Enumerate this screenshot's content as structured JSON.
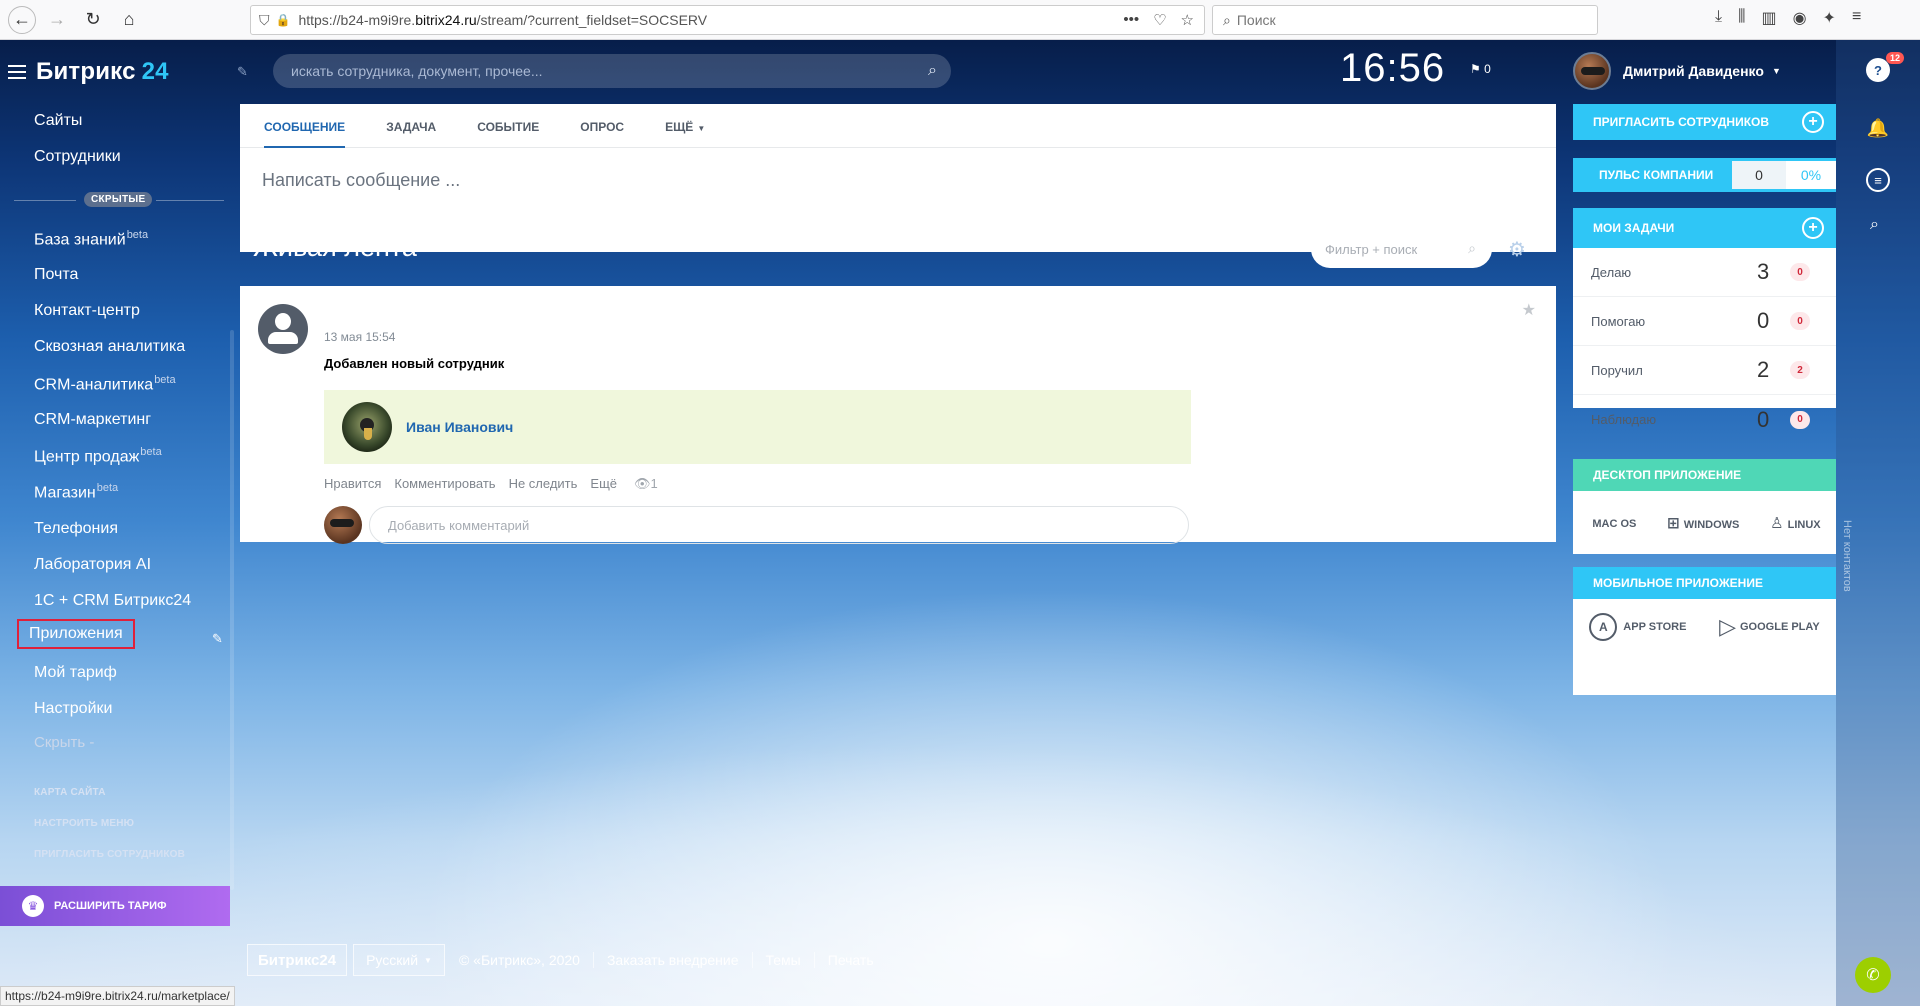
{
  "browser": {
    "url_prefix": "https://b24-m9i9re.",
    "url_host": "bitrix24.ru",
    "url_path": "/stream/?current_fieldset=SOCSERV",
    "search_placeholder": "Поиск",
    "status_url": "https://b24-m9i9re.bitrix24.ru/marketplace/"
  },
  "header": {
    "logo_name": "Битрикс",
    "logo_num": "24",
    "search_placeholder": "искать сотрудника, документ, прочее...",
    "clock": "16:56",
    "flag_count": "0",
    "user_name": "Дмитрий Давиденко"
  },
  "sidebar": {
    "top_items": [
      "Сайты",
      "Сотрудники"
    ],
    "hidden_label": "СКРЫТЫЕ",
    "items": [
      {
        "label": "База знаний",
        "sup": "beta"
      },
      {
        "label": "Почта",
        "sup": ""
      },
      {
        "label": "Контакт-центр",
        "sup": ""
      },
      {
        "label": "Сквозная аналитика",
        "sup": ""
      },
      {
        "label": "CRM-аналитика",
        "sup": "beta"
      },
      {
        "label": "CRM-маркетинг",
        "sup": ""
      },
      {
        "label": "Центр продаж",
        "sup": "beta"
      },
      {
        "label": "Магазин",
        "sup": "beta"
      },
      {
        "label": "Телефония",
        "sup": ""
      },
      {
        "label": "Лаборатория AI",
        "sup": ""
      },
      {
        "label": "1С + CRM Битрикс24",
        "sup": ""
      }
    ],
    "active_item": "Приложения",
    "after_items": [
      "Мой тариф",
      "Настройки",
      "Скрыть -"
    ],
    "small_links": [
      "КАРТА САЙТА",
      "НАСТРОИТЬ МЕНЮ",
      "ПРИГЛАСИТЬ СОТРУДНИКОВ"
    ],
    "upgrade_label": "РАСШИРИТЬ ТАРИФ"
  },
  "composer": {
    "tabs": [
      "СООБЩЕНИЕ",
      "ЗАДАЧА",
      "СОБЫТИЕ",
      "ОПРОС",
      "ЕЩЁ"
    ],
    "placeholder": "Написать сообщение ..."
  },
  "feed": {
    "title": "Живая лента",
    "filter_placeholder": "Фильтр + поиск"
  },
  "post": {
    "date": "13 мая 15:54",
    "title": "Добавлен новый сотрудник",
    "user": "Иван Иванович",
    "actions": [
      "Нравится",
      "Комментировать",
      "Не следить",
      "Ещё"
    ],
    "views": "1",
    "comment_placeholder": "Добавить комментарий"
  },
  "widgets": {
    "invite_label": "ПРИГЛАСИТЬ СОТРУДНИКОВ",
    "pulse_label": "ПУЛЬС КОМПАНИИ",
    "pulse_value": "0",
    "pulse_pct": "0%",
    "tasks_title": "МОИ ЗАДАЧИ",
    "tasks": [
      {
        "label": "Делаю",
        "count": "3",
        "badge": "0"
      },
      {
        "label": "Помогаю",
        "count": "0",
        "badge": "0"
      },
      {
        "label": "Поручил",
        "count": "2",
        "badge": "2"
      },
      {
        "label": "Наблюдаю",
        "count": "0",
        "badge": "0"
      }
    ],
    "desktop_title": "ДЕСКТОП ПРИЛОЖЕНИЕ",
    "desktop_apps": [
      "MAC OS",
      "WINDOWS",
      "LINUX"
    ],
    "mobile_title": "МОБИЛЬНОЕ ПРИЛОЖЕНИЕ",
    "mobile_apps": [
      "APP STORE",
      "GOOGLE PLAY"
    ]
  },
  "rail": {
    "help_badge": "12",
    "vertical_text": "Нет контактов"
  },
  "footer": {
    "logo": "Битрикс24",
    "lang": "Русский",
    "copyright": "© «Битрикс», 2020",
    "links": [
      "Заказать внедрение",
      "Темы",
      "Печать"
    ]
  },
  "colors": {
    "accent": "#2fc6f6",
    "link": "#2067b0",
    "desktop_head": "#4fd7b6",
    "upgrade": "#8b5be0",
    "highlight_box": "#e0203a"
  }
}
